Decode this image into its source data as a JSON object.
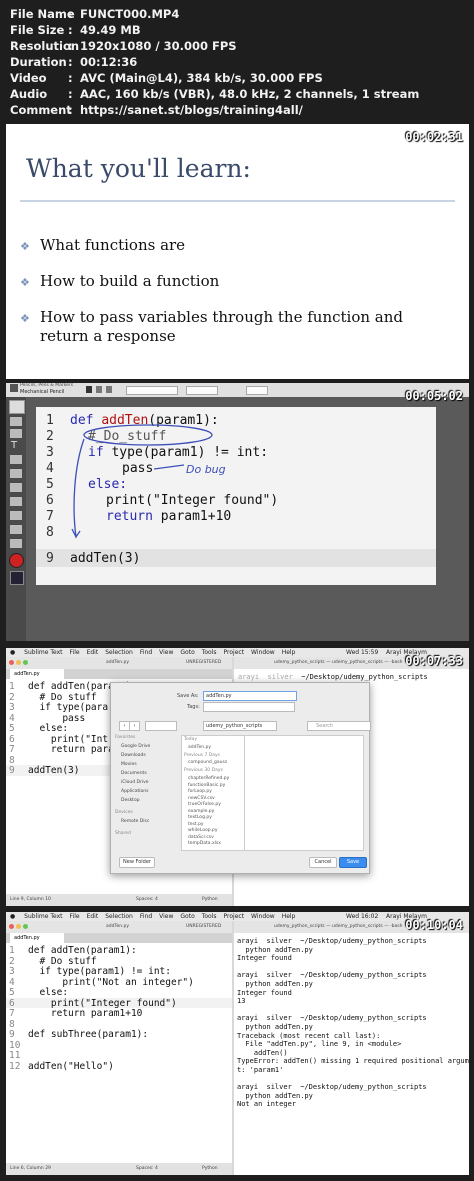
{
  "meta": {
    "file_name": {
      "key": "File Name",
      "value": "FUNCT000.MP4"
    },
    "file_size": {
      "key": "File Size",
      "value": "49.49 MB"
    },
    "resolution": {
      "key": "Resolution",
      "value": "1920x1080 / 30.000 FPS"
    },
    "duration": {
      "key": "Duration",
      "value": "00:12:36"
    },
    "video": {
      "key": "Video",
      "value": "AVC (Main@L4), 384 kb/s, 30.000 FPS"
    },
    "audio": {
      "key": "Audio",
      "value": "AAC, 160 kb/s (VBR), 48.0 kHz, 2 channels, 1 stream"
    },
    "comment": {
      "key": "Comment",
      "value": "https://sanet.st/blogs/training4all/"
    }
  },
  "panel1": {
    "timestamp": "00:02:31",
    "title": "What you'll learn:",
    "bullets": [
      "What functions are",
      "How to build a function",
      "How to pass variables through the function and return a response"
    ]
  },
  "panel2": {
    "timestamp": "00:05:02",
    "tool_title": "Pencils, Pens & Markers",
    "tool_name": "Mechanical Pencil",
    "line_numbers": [
      "1",
      "2",
      "3",
      "4",
      "5",
      "6",
      "7",
      "8",
      "9"
    ],
    "code": {
      "l1_kw": "def",
      "l1_fn": "addTen",
      "l1_rest": "(param1):",
      "l2": "#_Do_stuff",
      "l3_kw": "if",
      "l3_rest": " type(param1) != int:",
      "l4": "pass",
      "l5_kw": "else:",
      "l6": "print(\"Integer found\")",
      "l7_kw": "return",
      "l7_rest": " param1+10",
      "l9": "addTen(3)"
    },
    "annotation": "Do bug"
  },
  "panel3": {
    "timestamp": "00:07:33",
    "menu": [
      "Sublime Text",
      "File",
      "Edit",
      "Selection",
      "Find",
      "View",
      "Goto",
      "Tools",
      "Project",
      "Window",
      "Help"
    ],
    "clock": "Wed 15:59",
    "user": "Arayi Melaym",
    "tab": "addTen.py",
    "tab2": "UNREGISTERED",
    "line_numbers": [
      "1",
      "2",
      "3",
      "4",
      "5",
      "6",
      "7",
      "8",
      "9"
    ],
    "code": [
      "def addTen(param1):",
      "  # Do stuff",
      "  if type(para",
      "      pass",
      "  else:",
      "    print(\"Int",
      "    return param",
      "",
      "addTen(3)"
    ],
    "terminal_title": "udemy_python_scripts — udemy_python_scripts — -bash",
    "prompt_user": "arayi",
    "prompt_host": "silver",
    "prompt_path": "~/Desktop/udemy_python_scripts",
    "dialog": {
      "save_as_label": "Save As:",
      "save_as_value": "addTen.py",
      "tags_label": "Tags:",
      "folder": "udemy_python_scripts",
      "search_placeholder": "Search",
      "favorites_heading": "Favorites",
      "favorites": [
        "Google Drive",
        "Downloads",
        "Movies",
        "Documents",
        "iCloud Drive",
        "Applications",
        "Desktop"
      ],
      "devices_heading": "Devices",
      "devices": [
        "Remote Disc"
      ],
      "shared_heading": "Shared",
      "list_headings": [
        "Today",
        "Previous 7 Days",
        "Previous 30 Days"
      ],
      "files": [
        "addTen.py",
        "compound_gauss",
        "chapterRefined.py",
        "functionBasic.py",
        "forLoop.py",
        "newCSV.csv",
        "trueOrFalse.py",
        "example.py",
        "textLog.py",
        "test.py",
        "whileLoop.py",
        "dataScr.csv",
        "tempData.xlsx"
      ],
      "new_folder": "New Folder",
      "cancel": "Cancel",
      "save": "Save"
    },
    "status_left": "Line 9, Column 10",
    "status_mid": "Spaces: 4",
    "status_right": "Python"
  },
  "panel4": {
    "timestamp": "00:10:04",
    "menu": [
      "Sublime Text",
      "File",
      "Edit",
      "Selection",
      "Find",
      "View",
      "Goto",
      "Tools",
      "Project",
      "Window",
      "Help"
    ],
    "clock": "Wed 16:02",
    "user": "Arayi Melaym",
    "tab": "addTen.py",
    "tab2": "UNREGISTERED",
    "line_numbers": [
      "1",
      "2",
      "3",
      "4",
      "5",
      "6",
      "7",
      "8",
      "9",
      "10",
      "11",
      "12"
    ],
    "code": [
      "def addTen(param1):",
      "  # Do stuff",
      "  if type(param1) != int:",
      "      print(\"Not an integer\")",
      "  else:",
      "    print(\"Integer found\")",
      "    return param1+10",
      "",
      "def subThree(param1):",
      "",
      "",
      "addTen(\"Hello\")"
    ],
    "terminal_title": "udemy_python_scripts — udemy_python_scripts — -bash",
    "terminal": [
      "arayi  silver  ~/Desktop/udemy_python_scripts",
      "  python addTen.py",
      "Integer found",
      "",
      "arayi  silver  ~/Desktop/udemy_python_scripts",
      "  python addTen.py",
      "Integer found",
      "13",
      "",
      "arayi  silver  ~/Desktop/udemy_python_scripts",
      "  python addTen.py",
      "Traceback (most recent call last):",
      "  File \"addTen.py\", line 9, in <module>",
      "    addTen()",
      "TypeError: addTen() missing 1 required positional argumen",
      "t: 'param1'",
      "",
      "arayi  silver  ~/Desktop/udemy_python_scripts",
      "  python addTen.py",
      "Not an integer"
    ],
    "status_left": "Line 6, Column 29",
    "status_mid": "Spaces: 4",
    "status_right": "Python"
  }
}
